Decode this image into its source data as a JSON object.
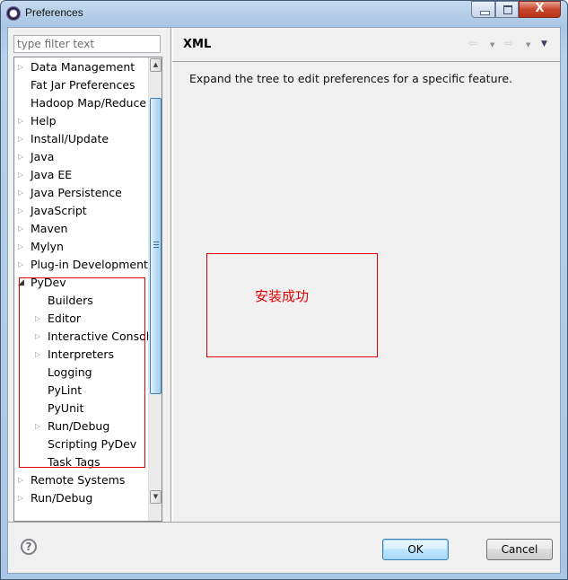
{
  "window": {
    "title": "Preferences",
    "controls": {
      "minimize": "–",
      "maximize": "□",
      "close": "X"
    }
  },
  "filter": {
    "placeholder": "type filter text",
    "value": ""
  },
  "tree": {
    "items": [
      {
        "label": "Data Management",
        "expandable": true,
        "expanded": false,
        "level": 0
      },
      {
        "label": "Fat Jar Preferences",
        "expandable": false,
        "level": 0
      },
      {
        "label": "Hadoop Map/Reduce",
        "expandable": false,
        "level": 0
      },
      {
        "label": "Help",
        "expandable": true,
        "expanded": false,
        "level": 0
      },
      {
        "label": "Install/Update",
        "expandable": true,
        "expanded": false,
        "level": 0
      },
      {
        "label": "Java",
        "expandable": true,
        "expanded": false,
        "level": 0
      },
      {
        "label": "Java EE",
        "expandable": true,
        "expanded": false,
        "level": 0
      },
      {
        "label": "Java Persistence",
        "expandable": true,
        "expanded": false,
        "level": 0
      },
      {
        "label": "JavaScript",
        "expandable": true,
        "expanded": false,
        "level": 0
      },
      {
        "label": "Maven",
        "expandable": true,
        "expanded": false,
        "level": 0
      },
      {
        "label": "Mylyn",
        "expandable": true,
        "expanded": false,
        "level": 0
      },
      {
        "label": "Plug-in Development",
        "expandable": true,
        "expanded": false,
        "level": 0
      },
      {
        "label": "PyDev",
        "expandable": true,
        "expanded": true,
        "level": 0
      },
      {
        "label": "Builders",
        "expandable": false,
        "level": 1
      },
      {
        "label": "Editor",
        "expandable": true,
        "expanded": false,
        "level": 1
      },
      {
        "label": "Interactive Console",
        "expandable": true,
        "expanded": false,
        "level": 1
      },
      {
        "label": "Interpreters",
        "expandable": true,
        "expanded": false,
        "level": 1
      },
      {
        "label": "Logging",
        "expandable": false,
        "level": 1
      },
      {
        "label": "PyLint",
        "expandable": false,
        "level": 1
      },
      {
        "label": "PyUnit",
        "expandable": false,
        "level": 1
      },
      {
        "label": "Run/Debug",
        "expandable": true,
        "expanded": false,
        "level": 1
      },
      {
        "label": "Scripting PyDev",
        "expandable": false,
        "level": 1
      },
      {
        "label": "Task Tags",
        "expandable": false,
        "level": 1
      },
      {
        "label": "Remote Systems",
        "expandable": true,
        "expanded": false,
        "level": 0
      },
      {
        "label": "Run/Debug",
        "expandable": true,
        "expanded": false,
        "level": 0
      }
    ],
    "scrollbar": {
      "up": "▲",
      "down": "▼",
      "left": "◀",
      "right": "▶",
      "hgrip": "III"
    }
  },
  "page": {
    "title": "XML",
    "description": "Expand the tree to edit preferences for a specific feature.",
    "nav": {
      "back": "⇦",
      "back_menu": "▼",
      "forward": "⇨",
      "forward_menu": "▼",
      "view_menu": "▼"
    }
  },
  "annotation": {
    "text": "安装成功",
    "color": "#e00000"
  },
  "footer": {
    "help": "?",
    "ok_label": "OK",
    "cancel_label": "Cancel"
  }
}
